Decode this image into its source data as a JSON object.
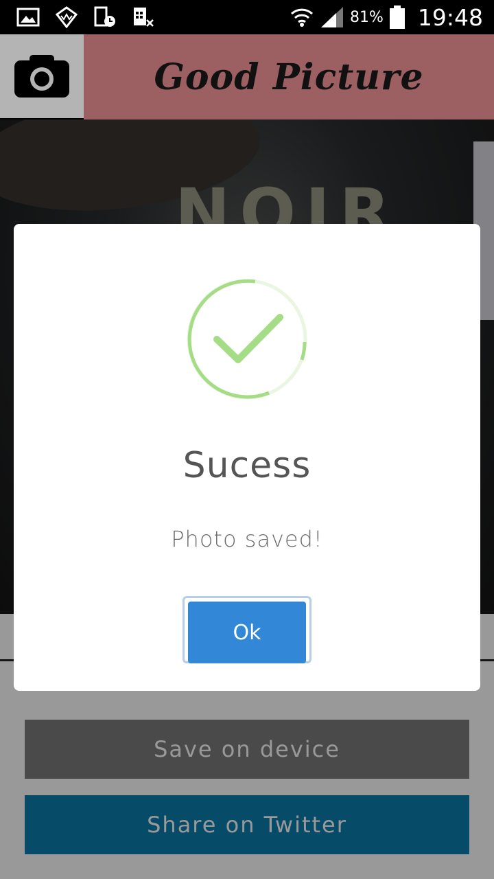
{
  "status_bar": {
    "battery_percent": "81%",
    "time": "19:48",
    "icons": [
      "image-icon",
      "vpn-icon",
      "sim-clock-icon",
      "no-sim-icon",
      "wifi-icon",
      "signal-icon",
      "battery-icon"
    ]
  },
  "header": {
    "title": "Good Picture",
    "camera_icon": "camera-icon",
    "title_bg": "#9c5f62"
  },
  "preview": {
    "text": "NOIR"
  },
  "dialog": {
    "title": "Sucess",
    "message": "Photo saved!",
    "ok_label": "Ok",
    "icon": "checkmark-circle-icon",
    "accent": "#a5dc86",
    "button_color": "#3387d7"
  },
  "actions": {
    "save_label": "Save on device",
    "twitter_label": "Share on Twitter",
    "twitter_color": "#0a7fae"
  }
}
